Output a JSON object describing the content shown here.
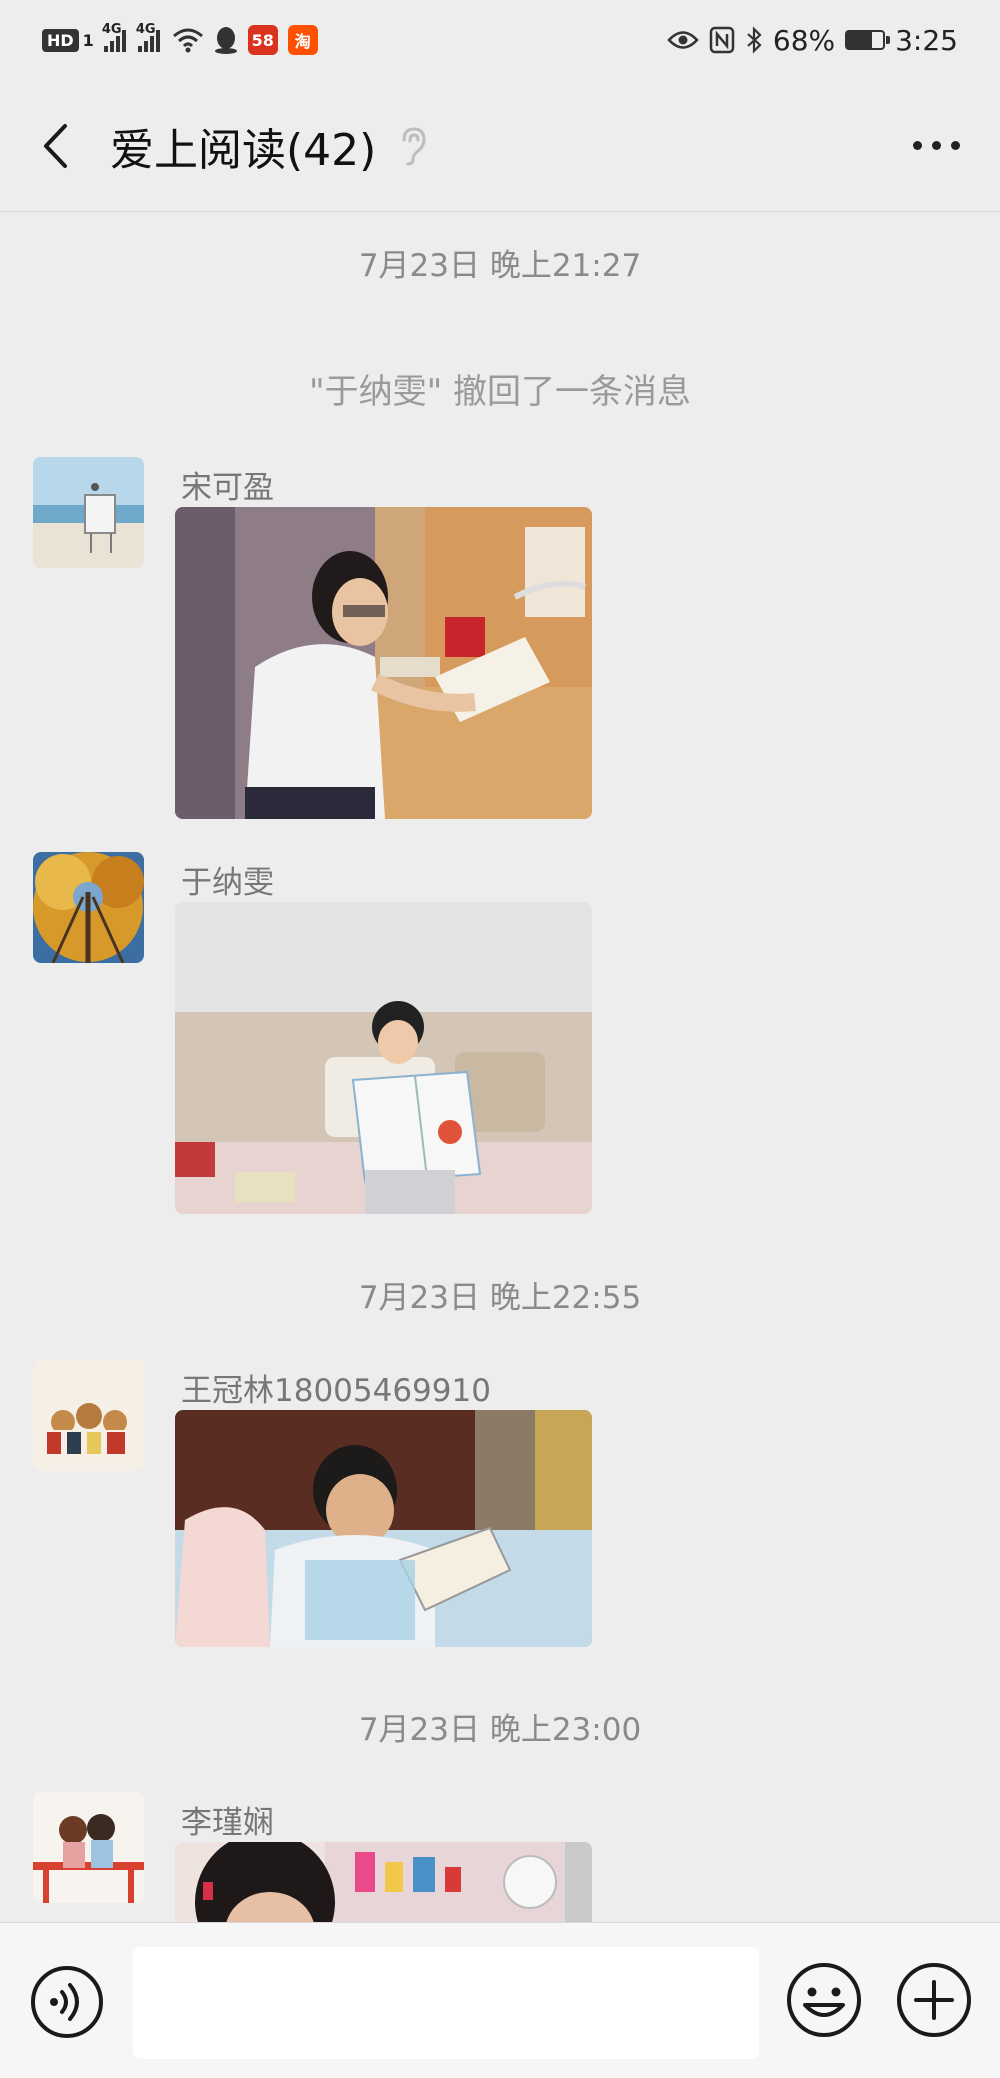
{
  "status_bar": {
    "hd_label": "HD",
    "sim_digit": "1",
    "network_1": "4G",
    "network_2": "4G",
    "badge_58": "58",
    "badge_tao": "淘",
    "battery_text": "68%",
    "battery_level": 0.68,
    "time": "3:25"
  },
  "header": {
    "title": "爱上阅读(42)"
  },
  "messages": {
    "ts1": "7月23日 晚上21:27",
    "recall": "\"于纳雯\" 撤回了一条消息",
    "m1_sender": "宋可盈",
    "m2_sender": "于纳雯",
    "ts2": "7月23日 晚上22:55",
    "m3_sender": "王冠林18005469910",
    "ts3": "7月23日 晚上23:00",
    "m4_sender": "李瑾娴"
  },
  "input": {
    "placeholder": ""
  },
  "icons": {
    "back": "chevron-left-icon",
    "ear": "ear-icon",
    "more": "more-dots-icon",
    "voice": "voice-icon",
    "emoji": "emoji-icon",
    "plus": "plus-icon"
  }
}
